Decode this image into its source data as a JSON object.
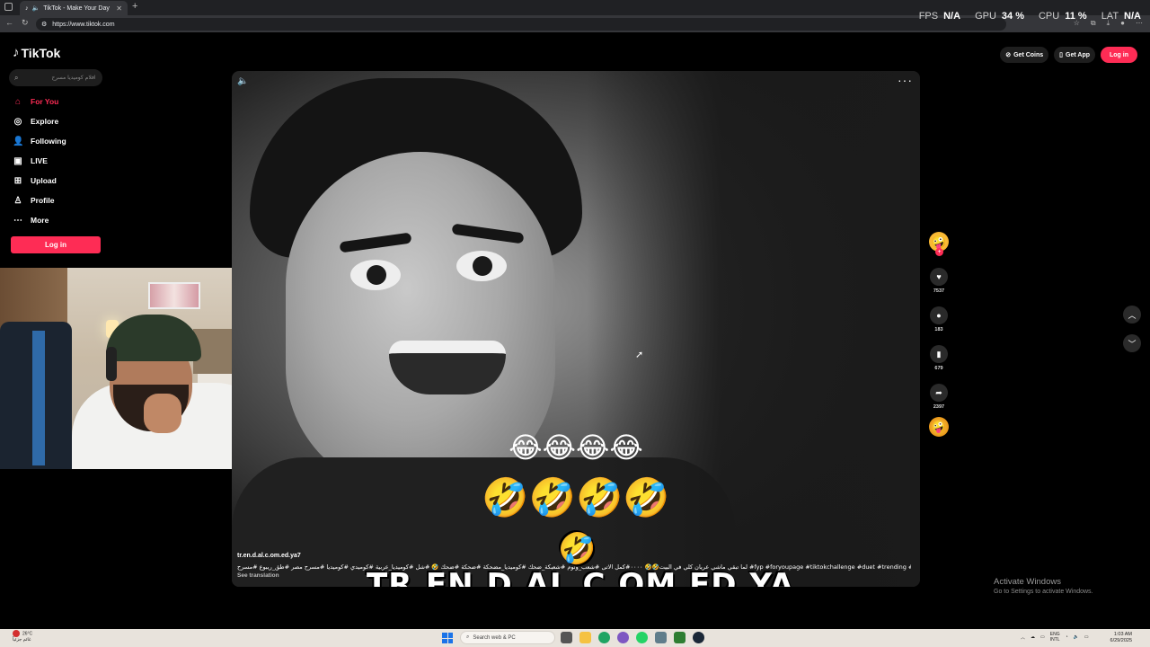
{
  "browser": {
    "tab_title": "TikTok - Make Your Day",
    "url": "https://www.tiktok.com"
  },
  "overlay": {
    "fps_label": "FPS",
    "fps_value": "N/A",
    "gpu_label": "GPU",
    "gpu_value": "34 %",
    "cpu_label": "CPU",
    "cpu_value": "11 %",
    "lat_label": "LAT",
    "lat_value": "N/A"
  },
  "tiktok": {
    "logo": "TikTok",
    "search_placeholder": "افلام كوميديا مسرح",
    "nav": [
      {
        "label": "For You",
        "icon": "home-icon",
        "active": true
      },
      {
        "label": "Explore",
        "icon": "compass-icon"
      },
      {
        "label": "Following",
        "icon": "user-follow-icon"
      },
      {
        "label": "LIVE",
        "icon": "live-icon"
      },
      {
        "label": "Upload",
        "icon": "plus-square-icon"
      },
      {
        "label": "Profile",
        "icon": "person-icon"
      },
      {
        "label": "More",
        "icon": "ellipsis-icon"
      }
    ],
    "sidebar_login": "Log in",
    "top": {
      "coins": "Get Coins",
      "app": "Get App",
      "login": "Log in"
    },
    "accent": "#fe2c55"
  },
  "video": {
    "emoji_row1": "😂😂😂😂",
    "emoji_row2": "🤣🤣🤣🤣",
    "watermark": "🤣 TR.EN.D.AL.C.OM.ED.YA 🤣",
    "username": "tr.en.d.al.c.om.ed.ya7",
    "caption": "لما تبقي ماشي عريان كلي في البيت🤣🤣 ٠٠٠٠#كمل الاتى #شعب_ونوم #شعبكة_ضحك #كوميديا_مضحكة #ضحكة #ضحك 🤣 #شل #كوميديا_عربية #كوميدي #كوميديا #مسرح مصر #طق_ريبوع #مسرح #fyp #foryoupage #tiktokchallenge #duet #trending #comedy",
    "see_translation": "See translation"
  },
  "actions": {
    "likes": "7537",
    "comments": "183",
    "saves": "679",
    "shares": "2397"
  },
  "activate": {
    "title": "Activate Windows",
    "subtitle": "Go to Settings to activate Windows."
  },
  "taskbar": {
    "weather_temp": "26°C",
    "weather_desc": "غائم جزئياً",
    "search": "Search web & PC",
    "lang_top": "ENG",
    "lang_bottom": "INTL",
    "time": "1:03 AM",
    "date": "6/29/2025"
  }
}
